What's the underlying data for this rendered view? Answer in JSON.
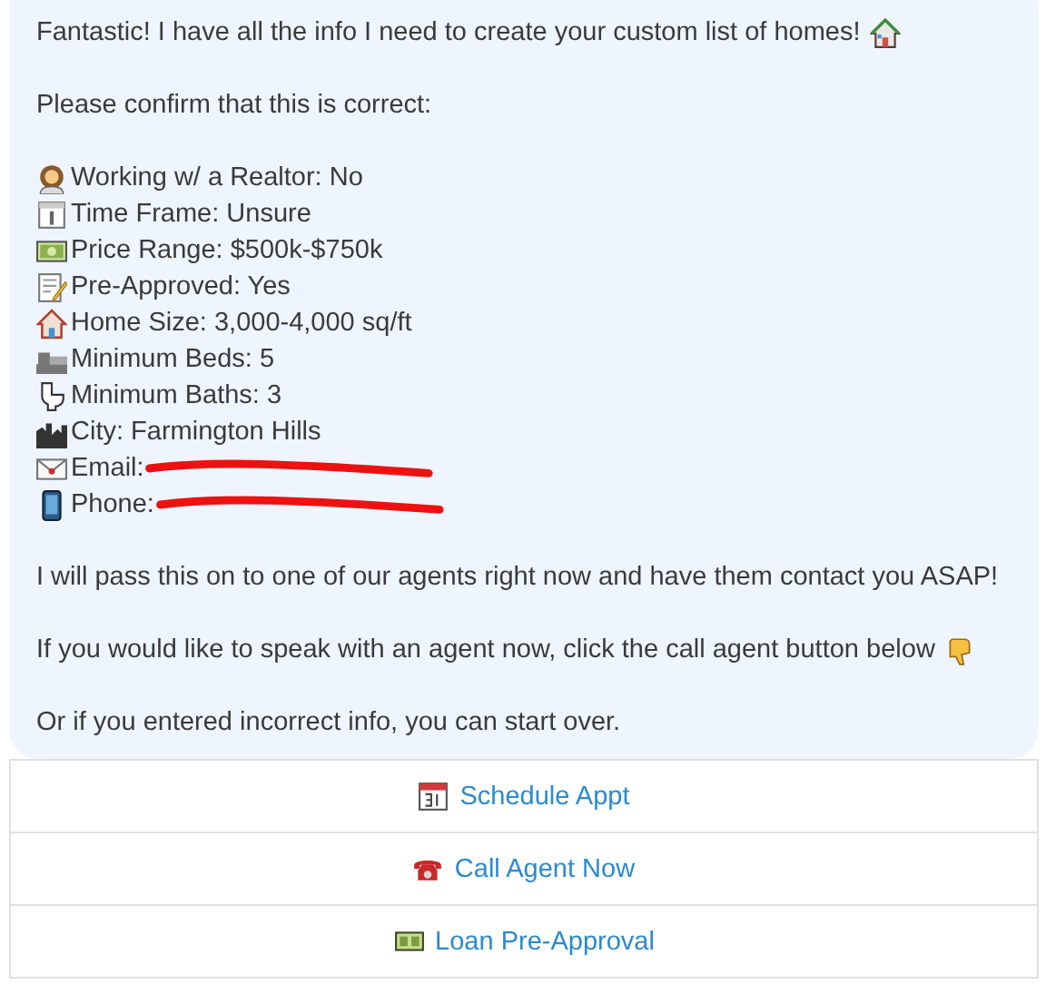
{
  "message": {
    "intro": "Fantastic! I have all the info I need to create your custom list of homes!",
    "confirm": "Please confirm that this is correct:",
    "details": [
      {
        "text": "Working w/ a Realtor: No",
        "redacted": false
      },
      {
        "text": "Time Frame: Unsure",
        "redacted": false
      },
      {
        "text": "Price Range: $500k-$750k",
        "redacted": false
      },
      {
        "text": "Pre-Approved: Yes",
        "redacted": false
      },
      {
        "text": "Home Size: 3,000-4,000 sq/ft",
        "redacted": false
      },
      {
        "text": "Minimum Beds: 5",
        "redacted": false
      },
      {
        "text": "Minimum Baths: 3",
        "redacted": false
      },
      {
        "text": "City: Farmington Hills",
        "redacted": false
      },
      {
        "text": "Email:",
        "redacted": true
      },
      {
        "text": "Phone:",
        "redacted": true
      }
    ],
    "notes": [
      "I will pass this on to one of our agents right now and have them contact you ASAP!",
      "If you would like to speak with an agent now, click the call agent button below",
      "Or if you entered incorrect info, you can start over."
    ]
  },
  "buttons": [
    {
      "label": "Schedule Appt"
    },
    {
      "label": "Call Agent Now"
    },
    {
      "label": "Loan Pre-Approval"
    }
  ]
}
